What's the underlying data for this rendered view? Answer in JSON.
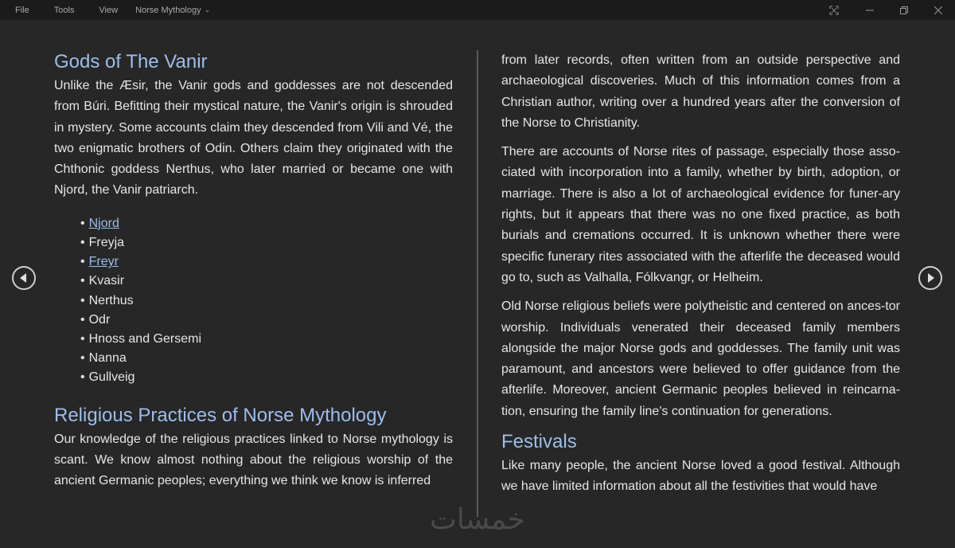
{
  "menubar": {
    "items": [
      "File",
      "Tools",
      "View"
    ],
    "document_title": "Norse Mythology"
  },
  "left": {
    "heading1": "Gods of The Vanir",
    "para1": "Unlike the Æsir, the Vanir gods and goddesses are not descended from Búri. Befitting their mystical nature, the Vanir's origin is shrouded in mystery. Some accounts claim they descended from Vili and Vé, the two enigmatic brothers of Odin. Others claim they originated with the Chthonic goddess Nerthus, who later married or became one with Njord, the Vanir patriarch.",
    "list": [
      "Njord",
      "Freyja",
      "Freyr",
      "Kvasir",
      "Nerthus",
      "Odr",
      "Hnoss and Gersemi",
      "Nanna",
      "Gullveig"
    ],
    "heading2": "Religious Practices of Norse Mythology",
    "para2": "Our knowledge of the religious practices linked to Norse mythology is scant. We know almost nothing about the religious worship of the ancient Germanic peoples; everything we think we know is inferred"
  },
  "right": {
    "para1": "from later records, often written from an outside perspective and archaeological discoveries. Much of this information comes from a Christian author, writing over a hundred years after the conversion of the Norse to Christianity.",
    "para2": "There are accounts of Norse rites of passage, especially those asso-ciated with incorporation into a family, whether by birth, adoption, or marriage. There is also a lot of archaeological evidence for funer-ary rights, but it appears that there was no one fixed practice, as both burials and cremations occurred. It is unknown whether there were specific funerary rites associated with the afterlife the deceased would go to, such as Valhalla, Fólkvangr, or Helheim.",
    "para3": "Old Norse religious beliefs were polytheistic and centered on ances-tor worship. Individuals venerated their deceased family members alongside the major Norse gods and goddesses. The family unit was paramount, and ancestors were believed to offer guidance from the afterlife. Moreover, ancient Germanic peoples believed in reincarna-tion, ensuring the family line's continuation for generations.",
    "heading": "Festivals",
    "para4": "Like many people, the ancient Norse loved a good festival. Although we have limited information about all the festivities that would have"
  },
  "watermark": "خمسات",
  "colors": {
    "background": "#272727",
    "heading": "#9dbdeb",
    "text": "#e6e6e6"
  },
  "icons": [
    "fullscreen-icon",
    "minimize-icon",
    "restore-icon",
    "close-icon",
    "previous-page-icon",
    "next-page-icon"
  ]
}
